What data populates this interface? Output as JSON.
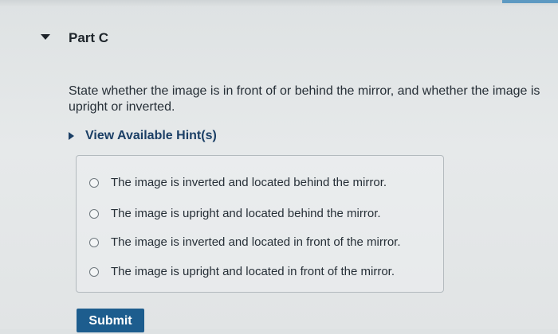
{
  "part": {
    "title": "Part C"
  },
  "question": {
    "text": "State whether the image is in front of or behind the mirror, and whether the image is upright or inverted."
  },
  "hints": {
    "label": "View Available Hint(s)"
  },
  "options": [
    {
      "label": "The image is inverted and located behind the mirror."
    },
    {
      "label": "The image is upright and located behind the mirror."
    },
    {
      "label": "The image is inverted and located in front of the mirror."
    },
    {
      "label": "The image is upright and located in front of the mirror."
    }
  ],
  "actions": {
    "submit_label": "Submit"
  },
  "colors": {
    "hint_link": "#1b3f66",
    "submit_button": "#1d5d8e"
  }
}
